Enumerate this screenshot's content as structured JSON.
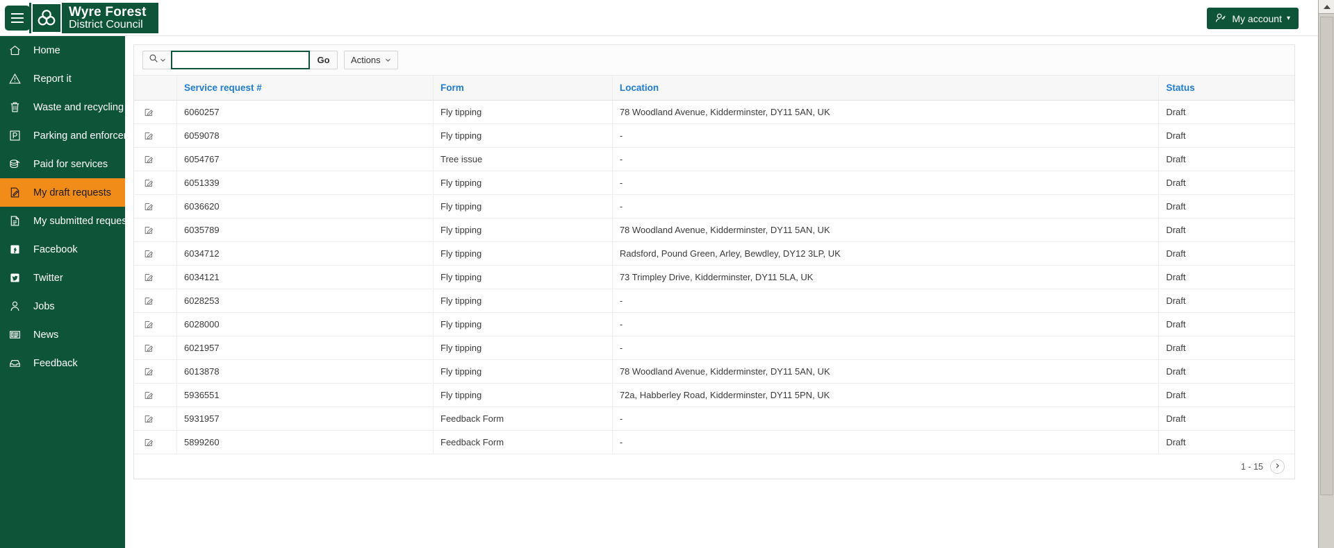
{
  "brand": {
    "line1": "Wyre Forest",
    "line2": "District Council",
    "logo_icon": "trefoil-logo-icon",
    "menu_icon": "hamburger-menu-icon"
  },
  "header": {
    "account_label": "My account",
    "account_icon": "user-key-icon",
    "account_caret": "▾"
  },
  "sidebar": {
    "items": [
      {
        "label": "Home",
        "icon": "home-icon",
        "active": false
      },
      {
        "label": "Report it",
        "icon": "warning-triangle-icon",
        "active": false
      },
      {
        "label": "Waste and recycling",
        "icon": "trash-bin-icon",
        "active": false
      },
      {
        "label": "Parking and enforcement",
        "icon": "parking-p-icon",
        "active": false
      },
      {
        "label": "Paid for services",
        "icon": "coins-stack-icon",
        "active": false
      },
      {
        "label": "My draft requests",
        "icon": "draft-document-icon",
        "active": true
      },
      {
        "label": "My submitted requests",
        "icon": "document-lines-icon",
        "active": false
      },
      {
        "label": "Facebook",
        "icon": "facebook-icon",
        "active": false
      },
      {
        "label": "Twitter",
        "icon": "twitter-icon",
        "active": false
      },
      {
        "label": "Jobs",
        "icon": "person-icon",
        "active": false
      },
      {
        "label": "News",
        "icon": "newspaper-icon",
        "active": false
      },
      {
        "label": "Feedback",
        "icon": "inbox-tray-icon",
        "active": false
      }
    ]
  },
  "toolbar": {
    "search_icon": "search-icon",
    "search_dropdown_icon": "chevron-down-icon",
    "search_value": "",
    "search_placeholder": "",
    "go_label": "Go",
    "actions_label": "Actions",
    "actions_caret_icon": "chevron-down-icon"
  },
  "table": {
    "columns": [
      {
        "key": "edit",
        "label": ""
      },
      {
        "key": "request",
        "label": "Service request #"
      },
      {
        "key": "form",
        "label": "Form"
      },
      {
        "key": "location",
        "label": "Location"
      },
      {
        "key": "status",
        "label": "Status"
      }
    ],
    "rows": [
      {
        "request": "6060257",
        "form": "Fly tipping",
        "location": "78 Woodland Avenue, Kidderminster, DY11 5AN, UK",
        "status": "Draft"
      },
      {
        "request": "6059078",
        "form": "Fly tipping",
        "location": "-",
        "status": "Draft"
      },
      {
        "request": "6054767",
        "form": "Tree issue",
        "location": "-",
        "status": "Draft"
      },
      {
        "request": "6051339",
        "form": "Fly tipping",
        "location": "-",
        "status": "Draft"
      },
      {
        "request": "6036620",
        "form": "Fly tipping",
        "location": "-",
        "status": "Draft"
      },
      {
        "request": "6035789",
        "form": "Fly tipping",
        "location": "78 Woodland Avenue, Kidderminster, DY11 5AN, UK",
        "status": "Draft"
      },
      {
        "request": "6034712",
        "form": "Fly tipping",
        "location": "Radsford, Pound Green, Arley, Bewdley, DY12 3LP, UK",
        "status": "Draft"
      },
      {
        "request": "6034121",
        "form": "Fly tipping",
        "location": "73 Trimpley Drive, Kidderminster, DY11 5LA, UK",
        "status": "Draft"
      },
      {
        "request": "6028253",
        "form": "Fly tipping",
        "location": "-",
        "status": "Draft"
      },
      {
        "request": "6028000",
        "form": "Fly tipping",
        "location": "-",
        "status": "Draft"
      },
      {
        "request": "6021957",
        "form": "Fly tipping",
        "location": "-",
        "status": "Draft"
      },
      {
        "request": "6013878",
        "form": "Fly tipping",
        "location": "78 Woodland Avenue, Kidderminster, DY11 5AN, UK",
        "status": "Draft"
      },
      {
        "request": "5936551",
        "form": "Fly tipping",
        "location": "72a, Habberley Road, Kidderminster, DY11 5PN, UK",
        "status": "Draft"
      },
      {
        "request": "5931957",
        "form": "Feedback Form",
        "location": "-",
        "status": "Draft"
      },
      {
        "request": "5899260",
        "form": "Feedback Form",
        "location": "-",
        "status": "Draft"
      }
    ],
    "row_edit_icon": "edit-pencil-icon"
  },
  "footer": {
    "page_range": "1 - 15",
    "next_icon": "chevron-right-icon"
  },
  "colors": {
    "brand_green": "#0e5438",
    "active_orange": "#f28c18",
    "header_link_blue": "#1f7bd4"
  }
}
